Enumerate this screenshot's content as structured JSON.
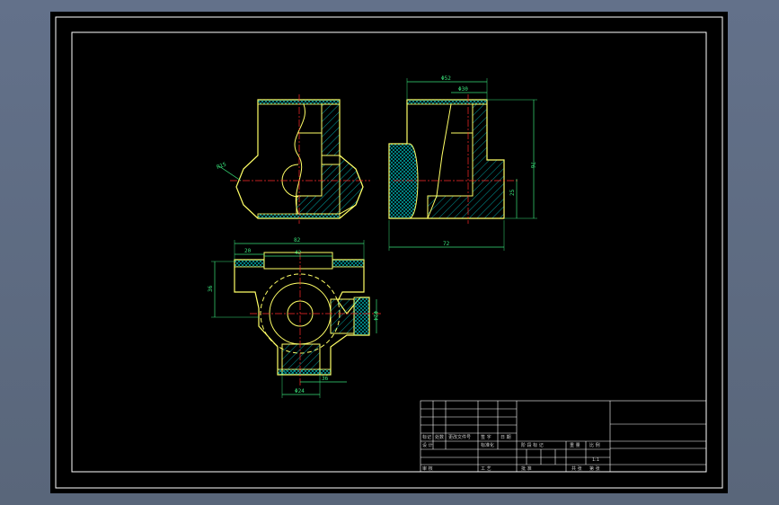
{
  "colors": {
    "background": "#5d6b7d",
    "sheet": "#000000",
    "outline": "#ffff66",
    "dimension": "#39e27a",
    "centerline": "#ff2a2a",
    "hatch": "#00c8c8",
    "frame": "#ffffff"
  },
  "views": {
    "front": {
      "radius_label": "R15"
    },
    "side": {
      "top_width_label": "Φ52",
      "bore_label": "Φ30",
      "height_label": "76",
      "boss_label": "25",
      "width_label": "72"
    },
    "top": {
      "overall_label": "82",
      "left_label": "20",
      "inner_label": "42",
      "depth_label": "36",
      "side_dia_label": "Φ24",
      "bottom_dia_label": "Φ24",
      "offset_label": "36"
    }
  },
  "title_block": {
    "row_labels": [
      "标记",
      "处数",
      "更改文件号",
      "签 字",
      "日 期"
    ],
    "design_label": "设 计",
    "standard_label": "标准化",
    "stage_label": "阶 段 标 记",
    "weight_label": "重 量",
    "scale_label": "比 例",
    "scale_value": "1:1",
    "review_label": "审 核",
    "process_label": "工 艺",
    "approve_label": "批 准",
    "sheets_label": "共  张",
    "sheet_no_label": "第  张"
  }
}
